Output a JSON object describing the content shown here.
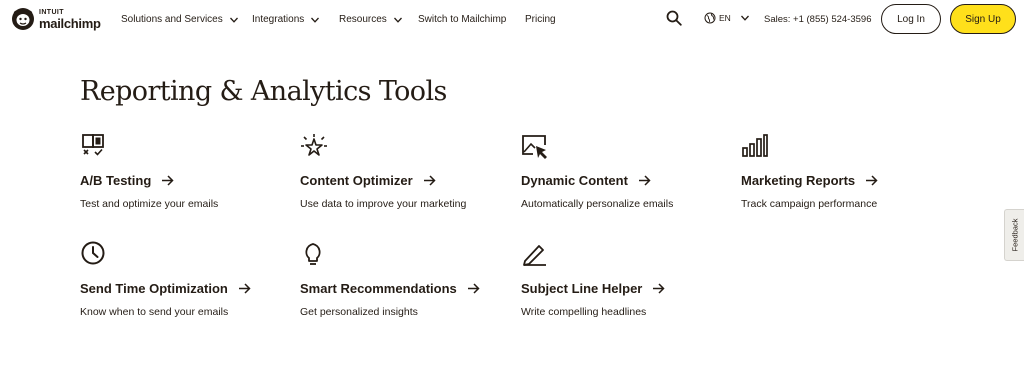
{
  "brand": {
    "intuit": "INTUIT",
    "name": "mailchimp",
    "logo_icon": "freddie-logo-icon"
  },
  "nav": {
    "items": [
      {
        "label": "Solutions and Services",
        "has_dropdown": true
      },
      {
        "label": "Integrations",
        "has_dropdown": true
      },
      {
        "label": "Resources",
        "has_dropdown": true
      },
      {
        "label": "Switch to Mailchimp",
        "has_dropdown": false
      },
      {
        "label": "Pricing",
        "has_dropdown": false
      }
    ],
    "search_icon": "search-icon",
    "language": "EN",
    "sales": "Sales: +1 (855) 524-3596",
    "login_label": "Log In",
    "signup_label": "Sign Up"
  },
  "colors": {
    "text": "#241c15",
    "accent_yellow": "#ffe01b",
    "background": "#ffffff"
  },
  "main": {
    "heading": "Reporting & Analytics Tools",
    "tools": [
      {
        "title": "A/B Testing",
        "description": "Test and optimize your emails",
        "icon": "ab-testing-icon"
      },
      {
        "title": "Content Optimizer",
        "description": "Use data to improve your marketing",
        "icon": "sparkle-icon"
      },
      {
        "title": "Dynamic Content",
        "description": "Automatically personalize emails",
        "icon": "image-cursor-icon"
      },
      {
        "title": "Marketing Reports",
        "description": "Track campaign performance",
        "icon": "bar-chart-icon"
      },
      {
        "title": "Send Time Optimization",
        "description": "Know when to send your emails",
        "icon": "clock-icon"
      },
      {
        "title": "Smart Recommendations",
        "description": "Get personalized insights",
        "icon": "lightbulb-icon"
      },
      {
        "title": "Subject Line Helper",
        "description": "Write compelling headlines",
        "icon": "pencil-icon"
      }
    ]
  },
  "feedback": {
    "label": "Feedback"
  }
}
